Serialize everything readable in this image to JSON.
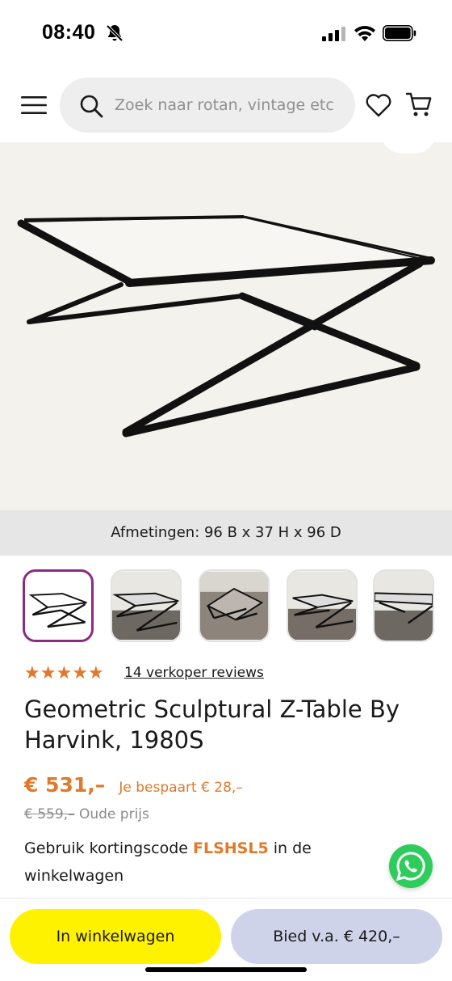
{
  "status_bar": {
    "time": "08:40",
    "icons": [
      "bell-off-icon",
      "signal-icon",
      "wifi-icon",
      "battery-icon"
    ]
  },
  "header": {
    "search": {
      "placeholder": "Zoek naar rotan, vintage etc"
    },
    "icons": [
      "menu-icon",
      "search-icon",
      "heart-icon",
      "cart-icon"
    ]
  },
  "product": {
    "dimensions": "Afmetingen: 96 B x 37 H x 96 D",
    "thumbnail_count": 5,
    "active_thumbnail": 1,
    "rating": {
      "stars": 5,
      "max": 5,
      "reviews_label": "14 verkoper reviews"
    },
    "title": "Geometric Sculptural Z-Table By Harvink, 1980S",
    "price": "€ 531,–",
    "savings": "Je bespaart € 28,–",
    "old_price": "€ 559,–",
    "old_price_label": "Oude prijs",
    "coupon": {
      "before": "Gebruik kortingscode",
      "code": "FLSHSL5",
      "after": "in de winkelwagen"
    }
  },
  "actions": {
    "add_to_cart": "In winkelwagen",
    "bid": "Bied v.a. € 420,–"
  },
  "colors": {
    "accent": "#e0792b",
    "cart_button": "#fff200",
    "bid_button": "#cfd3ea",
    "active_thumb_border": "#8a2c82",
    "whatsapp": "#2ecc5a"
  }
}
